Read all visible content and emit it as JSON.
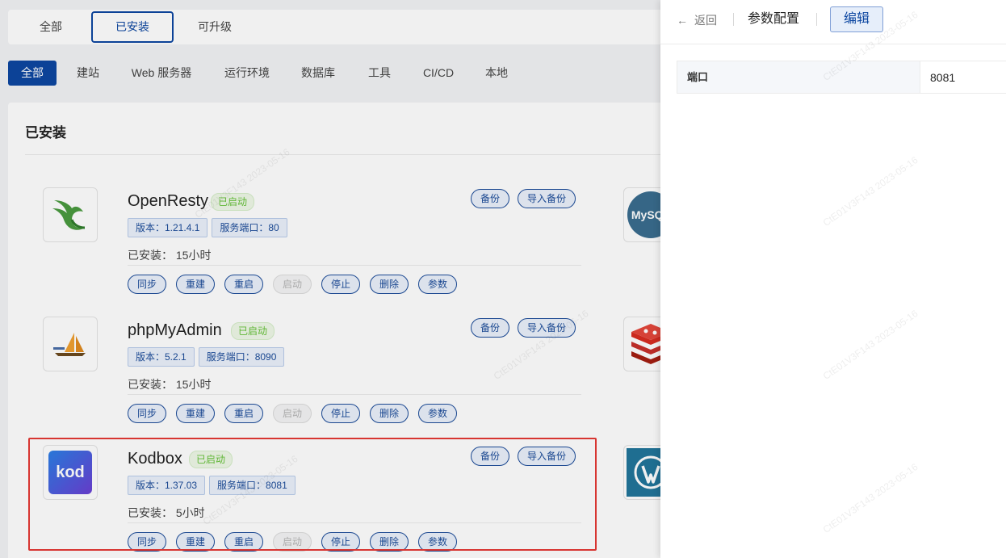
{
  "top_tabs": [
    {
      "label": "全部"
    },
    {
      "label": "已安装"
    },
    {
      "label": "可升级"
    }
  ],
  "categories": [
    {
      "label": "全部"
    },
    {
      "label": "建站"
    },
    {
      "label": "Web 服务器"
    },
    {
      "label": "运行环境"
    },
    {
      "label": "数据库"
    },
    {
      "label": "工具"
    },
    {
      "label": "CI/CD"
    },
    {
      "label": "本地"
    }
  ],
  "panel": {
    "title": "已安装"
  },
  "apps": [
    {
      "name": "OpenResty",
      "status": "已启动",
      "version": "版本：1.21.4.1",
      "port": "服务端口：80",
      "installed": "已安装：  15小时",
      "backup": "备份",
      "import_backup": "导入备份",
      "actions": [
        "同步",
        "重建",
        "重启",
        "启动",
        "停止",
        "删除",
        "参数"
      ]
    },
    {
      "name": "phpMyAdmin",
      "status": "已启动",
      "version": "版本：5.2.1",
      "port": "服务端口：8090",
      "installed": "已安装：  15小时",
      "backup": "备份",
      "import_backup": "导入备份",
      "actions": [
        "同步",
        "重建",
        "重启",
        "启动",
        "停止",
        "删除",
        "参数"
      ]
    },
    {
      "name": "Kodbox",
      "status": "已启动",
      "version": "版本：1.37.03",
      "port": "服务端口：8081",
      "installed": "已安装：  5小时",
      "backup": "备份",
      "import_backup": "导入备份",
      "actions": [
        "同步",
        "重建",
        "重启",
        "启动",
        "停止",
        "删除",
        "参数"
      ]
    }
  ],
  "logos": {
    "openresty": "openresty-bird-icon",
    "phpmyadmin": "phpmyadmin-sailboat-icon",
    "kodbox": "kod",
    "mysql": "MySQL",
    "redis": "redis-icon",
    "wordpress": "wordpress-icon"
  },
  "drawer": {
    "back": "返回",
    "title": "参数配置",
    "edit": "编辑",
    "params": [
      {
        "key": "端口",
        "value": "8081"
      }
    ]
  },
  "watermark": "CtE01V3F143  2023-05-16",
  "colors": {
    "primary": "#0d47a1",
    "success": "#67c23a",
    "highlight": "#e53935"
  }
}
